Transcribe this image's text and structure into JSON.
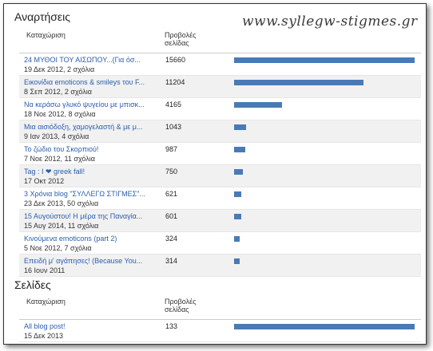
{
  "watermark": "www.syllegw-stigmes.gr",
  "colors": {
    "link": "#2a5db0",
    "bar": "#4a7ab5",
    "shade": "#f1f1f1"
  },
  "posts": {
    "section_title": "Αναρτήσεις",
    "col_entry": "Καταχώριση",
    "col_views": "Προβολές σελίδας",
    "max_views": 15660,
    "rows": [
      {
        "title": "24 ΜΥΘΟΙ ΤΟΥ ΑΙΣΩΠΟΥ...(Για όσ...",
        "meta": "19 Δεκ 2012, 2 σχόλια",
        "views": 15660
      },
      {
        "title": "Εικονίδια emoticons & smileys του F...",
        "meta": "8 Σεπ 2012, 2 σχόλια",
        "views": 11204
      },
      {
        "title": "Να κεράσω γλυκό ψυγείου με μπισκ...",
        "meta": "18 Νοε 2012, 8 σχόλια",
        "views": 4165
      },
      {
        "title": "Μια αισιόδοξη, χαμογελαστή & με μ...",
        "meta": "9 Ιαν 2013, 4 σχόλια",
        "views": 1043
      },
      {
        "title": "Το ζώδιο του Σκορπιού!",
        "meta": "7 Νοε 2012, 11 σχόλια",
        "views": 987
      },
      {
        "title": "Tag : I ❤ greek fall!",
        "meta": "17 Οκτ 2012",
        "views": 750
      },
      {
        "title": "3 Χρόνια blog \"ΣΥΛΛΕΓΩ ΣΤΙΓΜΕΣ\"...",
        "meta": "23 Δεκ 2013, 50 σχόλια",
        "views": 621
      },
      {
        "title": "15 Αυγούστου! Η μέρα της Παναγία...",
        "meta": "15 Αυγ 2014, 11 σχόλια",
        "views": 601
      },
      {
        "title": "Κινούμενα emoticons (part 2)",
        "meta": "5 Νοε 2012, 7 σχόλια",
        "views": 324
      },
      {
        "title": "Επειδή μ' αγάπησες! (Because You...",
        "meta": "16 Ιουν 2011",
        "views": 314
      }
    ]
  },
  "pages": {
    "section_title": "Σελίδες",
    "col_entry": "Καταχώριση",
    "col_views": "Προβολές σελίδας",
    "max_views": 133,
    "rows": [
      {
        "title": "All blog post!",
        "meta": "15 Δεκ 2013",
        "views": 133
      }
    ]
  }
}
